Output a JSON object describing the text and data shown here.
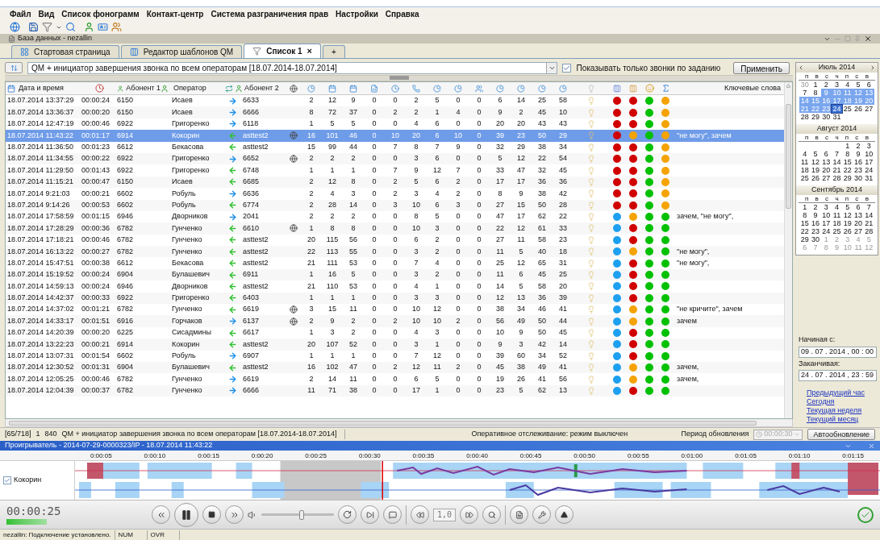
{
  "menu": [
    "Файл",
    "Вид",
    "Список фонограмм",
    "Контакт-центр",
    "Система разграничения прав",
    "Настройки",
    "Справка"
  ],
  "panel_title": "База данных - nezallin",
  "tabs": [
    {
      "label": "Стартовая страница",
      "selected": false,
      "kind": "page"
    },
    {
      "label": "Редактор шаблонов QM",
      "selected": false,
      "kind": "editor"
    },
    {
      "label": "Список 1",
      "selected": true,
      "kind": "list",
      "close": "×"
    },
    {
      "label": "+",
      "selected": false,
      "kind": "add"
    }
  ],
  "filter": {
    "value": "QM + инициатор завершения звонка по всем операторам [18.07.2014-18.07.2014]",
    "only_task_checkbox": {
      "label": "Показывать только звонки по заданию",
      "checked": true
    },
    "apply_button": "Применить"
  },
  "table": {
    "header": {
      "date": "Дата и время",
      "subscriber_1": "Абонент 1",
      "operator": "Оператор",
      "subscriber_2": "Абонент 2",
      "keywords": "Ключевые слова"
    },
    "rows": [
      {
        "cells": [
          "18.07.2014 13:37:29",
          "00:00:24",
          "6150",
          "Исаев",
          "6633"
        ],
        "kind": "outgoing",
        "marked": false,
        "nums": [
          "2",
          "12",
          "9",
          "0",
          "0",
          "2",
          "5",
          "0",
          "0",
          "6",
          "14",
          "25",
          "58"
        ],
        "dots": [
          {
            "color": "#d00000"
          },
          {
            "color": "#d00000"
          },
          {
            "color": "#00c000"
          },
          {
            "color": "#f5a300"
          }
        ],
        "selected": false
      },
      {
        "cells": [
          "18.07.2014 13:36:37",
          "00:00:20",
          "6150",
          "Исаев",
          "6666"
        ],
        "kind": "outgoing",
        "marked": false,
        "nums": [
          "8",
          "72",
          "37",
          "0",
          "2",
          "2",
          "1",
          "4",
          "0",
          "9",
          "2",
          "45",
          "10"
        ],
        "dots": [
          {
            "color": "#d00000"
          },
          {
            "color": "#d00000"
          },
          {
            "color": "#00c000"
          },
          {
            "color": "#f5a300"
          }
        ],
        "selected": false
      },
      {
        "cells": [
          "18.07.2014 12:47:19",
          "00:00:46",
          "6922",
          "Григоренко",
          "6118"
        ],
        "kind": "outgoing",
        "marked": false,
        "nums": [
          "1",
          "5",
          "5",
          "0",
          "0",
          "4",
          "6",
          "0",
          "0",
          "20",
          "20",
          "43",
          "43"
        ],
        "dots": [
          {
            "color": "#d00000"
          },
          {
            "color": "#d00000"
          },
          {
            "color": "#00c000"
          },
          {
            "color": "#f5a300"
          }
        ],
        "selected": false
      },
      {
        "cells": [
          "18.07.2014 11:43:22",
          "00:01:17",
          "6914",
          "Кокорин",
          "asttest2"
        ],
        "kind": "incoming",
        "marked": true,
        "nums": [
          "16",
          "101",
          "46",
          "0",
          "10",
          "20",
          "6",
          "10",
          "0",
          "39",
          "23",
          "50",
          "29"
        ],
        "dots": [
          {
            "color": "#d00000"
          },
          {
            "color": "#f5a300"
          },
          {
            "color": "#00c000"
          },
          {
            "color": "#f5a300"
          }
        ],
        "keywords": "\"не могу\", зачем",
        "selected": true
      },
      {
        "cells": [
          "18.07.2014 11:36:50",
          "00:01:23",
          "6612",
          "Бекасова",
          "asttest2"
        ],
        "kind": "incoming",
        "marked": false,
        "nums": [
          "15",
          "99",
          "44",
          "0",
          "7",
          "8",
          "7",
          "9",
          "0",
          "32",
          "29",
          "38",
          "34"
        ],
        "dots": [
          {
            "color": "#d00000"
          },
          {
            "color": "#d00000"
          },
          {
            "color": "#00c000"
          },
          {
            "color": "#f5a300"
          }
        ],
        "selected": false
      },
      {
        "cells": [
          "18.07.2014 11:34:55",
          "00:00:22",
          "6922",
          "Григоренко",
          "6652"
        ],
        "kind": "outgoing",
        "marked": true,
        "nums": [
          "2",
          "2",
          "2",
          "0",
          "0",
          "3",
          "6",
          "0",
          "0",
          "5",
          "12",
          "22",
          "54"
        ],
        "dots": [
          {
            "color": "#d00000"
          },
          {
            "color": "#d00000"
          },
          {
            "color": "#00c000"
          },
          {
            "color": "#f5a300"
          }
        ],
        "selected": false
      },
      {
        "cells": [
          "18.07.2014 11:29:50",
          "00:01:43",
          "6922",
          "Григоренко",
          "6748"
        ],
        "kind": "incoming",
        "marked": false,
        "nums": [
          "1",
          "1",
          "1",
          "0",
          "7",
          "9",
          "12",
          "7",
          "0",
          "33",
          "47",
          "32",
          "45"
        ],
        "dots": [
          {
            "color": "#d00000"
          },
          {
            "color": "#d00000"
          },
          {
            "color": "#00c000"
          },
          {
            "color": "#f5a300"
          }
        ],
        "selected": false
      },
      {
        "cells": [
          "18.07.2014 11:15:21",
          "00:00:47",
          "6150",
          "Исаев",
          "6685"
        ],
        "kind": "incoming",
        "marked": false,
        "nums": [
          "2",
          "12",
          "8",
          "0",
          "2",
          "5",
          "6",
          "2",
          "0",
          "17",
          "17",
          "36",
          "36"
        ],
        "dots": [
          {
            "color": "#d00000"
          },
          {
            "color": "#d00000"
          },
          {
            "color": "#00c000"
          },
          {
            "color": "#f5a300"
          }
        ],
        "selected": false
      },
      {
        "cells": [
          "18.07.2014 9:21:03",
          "00:00:21",
          "6602",
          "Робуль",
          "6636"
        ],
        "kind": "outgoing",
        "marked": false,
        "nums": [
          "2",
          "4",
          "3",
          "0",
          "2",
          "3",
          "4",
          "2",
          "0",
          "8",
          "9",
          "38",
          "42"
        ],
        "dots": [
          {
            "color": "#d00000"
          },
          {
            "color": "#d00000"
          },
          {
            "color": "#00c000"
          },
          {
            "color": "#f5a300"
          }
        ],
        "selected": false
      },
      {
        "cells": [
          "18.07.2014 9:14:26",
          "00:00:53",
          "6602",
          "Робуль",
          "6774"
        ],
        "kind": "incoming",
        "marked": false,
        "nums": [
          "2",
          "28",
          "14",
          "0",
          "3",
          "10",
          "6",
          "3",
          "0",
          "27",
          "15",
          "50",
          "28"
        ],
        "dots": [
          {
            "color": "#d00000"
          },
          {
            "color": "#d00000"
          },
          {
            "color": "#00c000"
          },
          {
            "color": "#f5a300"
          }
        ],
        "selected": false
      },
      {
        "cells": [
          "18.07.2014 17:58:59",
          "00:01:15",
          "6946",
          "Дворников",
          "2041"
        ],
        "kind": "outgoing",
        "marked": false,
        "nums": [
          "2",
          "2",
          "2",
          "0",
          "0",
          "8",
          "5",
          "0",
          "0",
          "47",
          "17",
          "62",
          "22"
        ],
        "dots": [
          {
            "color": "#1ea0f0"
          },
          {
            "color": "#f5a300"
          },
          {
            "color": "#00c000"
          },
          {
            "color": "#00c000"
          }
        ],
        "keywords": "зачем, \"не могу\",",
        "selected": false
      },
      {
        "cells": [
          "18.07.2014 17:28:29",
          "00:00:36",
          "6782",
          "Гунченко",
          "6610"
        ],
        "kind": "incoming",
        "marked": true,
        "nums": [
          "1",
          "8",
          "8",
          "0",
          "0",
          "10",
          "3",
          "0",
          "0",
          "22",
          "12",
          "61",
          "33"
        ],
        "dots": [
          {
            "color": "#1ea0f0"
          },
          {
            "color": "#d00000"
          },
          {
            "color": "#00c000"
          },
          {
            "color": "#00c000"
          }
        ],
        "selected": false
      },
      {
        "cells": [
          "18.07.2014 17:18:21",
          "00:00:46",
          "6782",
          "Гунченко",
          "asttest2"
        ],
        "kind": "incoming",
        "marked": false,
        "nums": [
          "20",
          "115",
          "56",
          "0",
          "0",
          "6",
          "2",
          "0",
          "0",
          "27",
          "11",
          "58",
          "23"
        ],
        "dots": [
          {
            "color": "#1ea0f0"
          },
          {
            "color": "#d00000"
          },
          {
            "color": "#00c000"
          },
          {
            "color": "#00c000"
          }
        ],
        "selected": false
      },
      {
        "cells": [
          "18.07.2014 16:13:22",
          "00:00:27",
          "6782",
          "Гунченко",
          "asttest2"
        ],
        "kind": "incoming",
        "marked": false,
        "nums": [
          "22",
          "113",
          "55",
          "0",
          "0",
          "3",
          "2",
          "0",
          "0",
          "11",
          "5",
          "40",
          "18"
        ],
        "dots": [
          {
            "color": "#1ea0f0"
          },
          {
            "color": "#f5a300"
          },
          {
            "color": "#00c000"
          },
          {
            "color": "#00c000"
          }
        ],
        "keywords": "\"не могу\",",
        "selected": false
      },
      {
        "cells": [
          "18.07.2014 15:47:51",
          "00:00:38",
          "6612",
          "Бекасова",
          "asttest2"
        ],
        "kind": "incoming",
        "marked": false,
        "nums": [
          "21",
          "111",
          "53",
          "0",
          "0",
          "7",
          "4",
          "0",
          "0",
          "25",
          "12",
          "65",
          "31"
        ],
        "dots": [
          {
            "color": "#1ea0f0"
          },
          {
            "color": "#d00000"
          },
          {
            "color": "#00c000"
          },
          {
            "color": "#00c000"
          }
        ],
        "keywords": "\"не могу\",",
        "selected": false
      },
      {
        "cells": [
          "18.07.2014 15:19:52",
          "00:00:24",
          "6904",
          "Булашевич",
          "6911"
        ],
        "kind": "incoming",
        "marked": false,
        "nums": [
          "1",
          "16",
          "5",
          "0",
          "0",
          "3",
          "2",
          "0",
          "0",
          "11",
          "6",
          "45",
          "25"
        ],
        "dots": [
          {
            "color": "#1ea0f0"
          },
          {
            "color": "#d00000"
          },
          {
            "color": "#00c000"
          },
          {
            "color": "#00c000"
          }
        ],
        "selected": false
      },
      {
        "cells": [
          "18.07.2014 14:59:13",
          "00:00:24",
          "6946",
          "Дворников",
          "asttest2"
        ],
        "kind": "incoming",
        "marked": false,
        "nums": [
          "21",
          "110",
          "53",
          "0",
          "0",
          "4",
          "1",
          "0",
          "0",
          "14",
          "5",
          "58",
          "20"
        ],
        "dots": [
          {
            "color": "#1ea0f0"
          },
          {
            "color": "#d00000"
          },
          {
            "color": "#00c000"
          },
          {
            "color": "#00c000"
          }
        ],
        "selected": false
      },
      {
        "cells": [
          "18.07.2014 14:42:37",
          "00:00:33",
          "6922",
          "Григоренко",
          "6403"
        ],
        "kind": "incoming",
        "marked": false,
        "nums": [
          "1",
          "1",
          "1",
          "0",
          "0",
          "3",
          "3",
          "0",
          "0",
          "12",
          "13",
          "36",
          "39"
        ],
        "dots": [
          {
            "color": "#1ea0f0"
          },
          {
            "color": "#d00000"
          },
          {
            "color": "#00c000"
          },
          {
            "color": "#00c000"
          }
        ],
        "selected": false
      },
      {
        "cells": [
          "18.07.2014 14:37:02",
          "00:01:21",
          "6782",
          "Гунченко",
          "6619"
        ],
        "kind": "incoming",
        "marked": true,
        "nums": [
          "3",
          "15",
          "11",
          "0",
          "0",
          "10",
          "12",
          "0",
          "0",
          "38",
          "34",
          "46",
          "41"
        ],
        "dots": [
          {
            "color": "#1ea0f0"
          },
          {
            "color": "#f5a300"
          },
          {
            "color": "#00c000"
          },
          {
            "color": "#00c000"
          }
        ],
        "keywords": "\"не кричите\", зачем",
        "selected": false
      },
      {
        "cells": [
          "18.07.2014 14:33:17",
          "00:01:51",
          "6916",
          "Горчаков",
          "6137"
        ],
        "kind": "outgoing",
        "marked": true,
        "nums": [
          "2",
          "9",
          "2",
          "0",
          "2",
          "10",
          "10",
          "2",
          "0",
          "56",
          "49",
          "50",
          "44"
        ],
        "dots": [
          {
            "color": "#1ea0f0"
          },
          {
            "color": "#f5a300"
          },
          {
            "color": "#00c000"
          },
          {
            "color": "#00c000"
          }
        ],
        "keywords": "зачем",
        "selected": false
      },
      {
        "cells": [
          "18.07.2014 14:20:39",
          "00:00:20",
          "6225",
          "Сисадмины",
          "6617"
        ],
        "kind": "incoming",
        "marked": false,
        "nums": [
          "1",
          "3",
          "2",
          "0",
          "0",
          "4",
          "3",
          "0",
          "0",
          "10",
          "9",
          "50",
          "45"
        ],
        "dots": [
          {
            "color": "#1ea0f0"
          },
          {
            "color": "#d00000"
          },
          {
            "color": "#00c000"
          },
          {
            "color": "#00c000"
          }
        ],
        "selected": false
      },
      {
        "cells": [
          "18.07.2014 13:22:23",
          "00:00:21",
          "6914",
          "Кокорин",
          "asttest2"
        ],
        "kind": "incoming",
        "marked": false,
        "nums": [
          "20",
          "107",
          "52",
          "0",
          "0",
          "3",
          "1",
          "0",
          "0",
          "9",
          "3",
          "42",
          "14"
        ],
        "dots": [
          {
            "color": "#1ea0f0"
          },
          {
            "color": "#d00000"
          },
          {
            "color": "#00c000"
          },
          {
            "color": "#00c000"
          }
        ],
        "selected": false
      },
      {
        "cells": [
          "18.07.2014 13:07:31",
          "00:01:54",
          "6602",
          "Робуль",
          "6907"
        ],
        "kind": "outgoing",
        "marked": false,
        "nums": [
          "1",
          "1",
          "1",
          "0",
          "0",
          "7",
          "12",
          "0",
          "0",
          "39",
          "60",
          "34",
          "52"
        ],
        "dots": [
          {
            "color": "#1ea0f0"
          },
          {
            "color": "#d00000"
          },
          {
            "color": "#00c000"
          },
          {
            "color": "#00c000"
          }
        ],
        "selected": false
      },
      {
        "cells": [
          "18.07.2014 12:30:52",
          "00:01:31",
          "6904",
          "Булашевич",
          "asttest2"
        ],
        "kind": "incoming",
        "marked": false,
        "nums": [
          "16",
          "102",
          "47",
          "0",
          "2",
          "12",
          "11",
          "2",
          "0",
          "45",
          "38",
          "49",
          "41"
        ],
        "dots": [
          {
            "color": "#1ea0f0"
          },
          {
            "color": "#f5a300"
          },
          {
            "color": "#00c000"
          },
          {
            "color": "#00c000"
          }
        ],
        "keywords": "зачем,",
        "selected": false
      },
      {
        "cells": [
          "18.07.2014 12:05:25",
          "00:00:46",
          "6782",
          "Гунченко",
          "6619"
        ],
        "kind": "outgoing",
        "marked": false,
        "nums": [
          "2",
          "14",
          "11",
          "0",
          "0",
          "6",
          "5",
          "0",
          "0",
          "19",
          "26",
          "41",
          "56"
        ],
        "dots": [
          {
            "color": "#1ea0f0"
          },
          {
            "color": "#f5a300"
          },
          {
            "color": "#00c000"
          },
          {
            "color": "#00c000"
          }
        ],
        "keywords": "зачем,",
        "selected": false
      },
      {
        "cells": [
          "18.07.2014 12:04:39",
          "00:00:37",
          "6782",
          "Гунченко",
          "6666"
        ],
        "kind": "outgoing",
        "marked": false,
        "nums": [
          "11",
          "71",
          "38",
          "0",
          "0",
          "17",
          "1",
          "0",
          "0",
          "23",
          "5",
          "62",
          "13"
        ],
        "dots": [
          {
            "color": "#1ea0f0"
          },
          {
            "color": "#d00000"
          },
          {
            "color": "#00c000"
          },
          {
            "color": "#00c000"
          }
        ],
        "selected": false
      }
    ]
  },
  "calendar": {
    "months": [
      {
        "title": "Июль 2014",
        "weekdays": [
          "п",
          "в",
          "с",
          "ч",
          "п",
          "с",
          "в"
        ],
        "weeks": [
          [
            {
              "d": "30",
              "muted": true,
              "selected": false,
              "current": false
            },
            {
              "d": "1",
              "muted": false,
              "selected": false,
              "current": false
            },
            {
              "d": "2",
              "muted": false,
              "selected": false,
              "current": false
            },
            {
              "d": "3",
              "muted": false,
              "selected": false,
              "current": false
            },
            {
              "d": "4",
              "muted": false,
              "selected": false,
              "current": false
            },
            {
              "d": "5",
              "muted": false,
              "selected": false,
              "current": false
            },
            {
              "d": "6",
              "muted": false,
              "selected": false,
              "current": false
            }
          ],
          [
            {
              "d": "7",
              "muted": false,
              "selected": false,
              "current": false
            },
            {
              "d": "8",
              "muted": false,
              "selected": false,
              "current": false
            },
            {
              "d": "9",
              "muted": false,
              "selected": true,
              "current": false
            },
            {
              "d": "10",
              "muted": false,
              "selected": true,
              "current": false
            },
            {
              "d": "11",
              "muted": false,
              "selected": true,
              "current": false
            },
            {
              "d": "12",
              "muted": false,
              "selected": true,
              "current": false
            },
            {
              "d": "13",
              "muted": false,
              "selected": true,
              "current": false
            }
          ],
          [
            {
              "d": "14",
              "muted": false,
              "selected": true,
              "current": false
            },
            {
              "d": "15",
              "muted": false,
              "selected": true,
              "current": false
            },
            {
              "d": "16",
              "muted": false,
              "selected": true,
              "current": false
            },
            {
              "d": "17",
              "muted": false,
              "selected": true,
              "current": false
            },
            {
              "d": "18",
              "muted": false,
              "selected": true,
              "current": false
            },
            {
              "d": "19",
              "muted": false,
              "selected": true,
              "current": false
            },
            {
              "d": "20",
              "muted": false,
              "selected": true,
              "current": false
            }
          ],
          [
            {
              "d": "21",
              "muted": false,
              "selected": true,
              "current": false
            },
            {
              "d": "22",
              "muted": false,
              "selected": true,
              "current": false
            },
            {
              "d": "23",
              "muted": false,
              "selected": true,
              "current": false
            },
            {
              "d": "24",
              "muted": false,
              "selected": true,
              "current": true
            },
            {
              "d": "25",
              "muted": false,
              "selected": false,
              "current": false
            },
            {
              "d": "26",
              "muted": false,
              "selected": false,
              "current": false
            },
            {
              "d": "27",
              "muted": false,
              "selected": false,
              "current": false
            }
          ],
          [
            {
              "d": "28",
              "muted": false,
              "selected": false,
              "current": false
            },
            {
              "d": "29",
              "muted": false,
              "selected": false,
              "current": false
            },
            {
              "d": "30",
              "muted": false,
              "selected": false,
              "current": false
            },
            {
              "d": "31",
              "muted": false,
              "selected": false,
              "current": false
            }
          ]
        ]
      },
      {
        "title": "Август 2014",
        "weekdays": [
          "п",
          "в",
          "с",
          "ч",
          "п",
          "с",
          "в"
        ],
        "weeks": [
          [
            {
              "d": "1",
              "muted": false,
              "selected": false,
              "current": false
            },
            {
              "d": "2",
              "muted": false,
              "selected": false,
              "current": false
            },
            {
              "d": "3",
              "muted": false,
              "selected": false,
              "current": false
            }
          ],
          [
            {
              "d": "4",
              "muted": false,
              "selected": false,
              "current": false
            },
            {
              "d": "5",
              "muted": false,
              "selected": false,
              "current": false
            },
            {
              "d": "6",
              "muted": false,
              "selected": false,
              "current": false
            },
            {
              "d": "7",
              "muted": false,
              "selected": false,
              "current": false
            },
            {
              "d": "8",
              "muted": false,
              "selected": false,
              "current": false
            },
            {
              "d": "9",
              "muted": false,
              "selected": false,
              "current": false
            },
            {
              "d": "10",
              "muted": false,
              "selected": false,
              "current": false
            }
          ],
          [
            {
              "d": "11",
              "muted": false,
              "selected": false,
              "current": false
            },
            {
              "d": "12",
              "muted": false,
              "selected": false,
              "current": false
            },
            {
              "d": "13",
              "muted": false,
              "selected": false,
              "current": false
            },
            {
              "d": "14",
              "muted": false,
              "selected": false,
              "current": false
            },
            {
              "d": "15",
              "muted": false,
              "selected": false,
              "current": false
            },
            {
              "d": "16",
              "muted": false,
              "selected": false,
              "current": false
            },
            {
              "d": "17",
              "muted": false,
              "selected": false,
              "current": false
            }
          ],
          [
            {
              "d": "18",
              "muted": false,
              "selected": false,
              "current": false
            },
            {
              "d": "19",
              "muted": false,
              "selected": false,
              "current": false
            },
            {
              "d": "20",
              "muted": false,
              "selected": false,
              "current": false
            },
            {
              "d": "21",
              "muted": false,
              "selected": false,
              "current": false
            },
            {
              "d": "22",
              "muted": false,
              "selected": false,
              "current": false
            },
            {
              "d": "23",
              "muted": false,
              "selected": false,
              "current": false
            },
            {
              "d": "24",
              "muted": false,
              "selected": false,
              "current": false
            }
          ],
          [
            {
              "d": "25",
              "muted": false,
              "selected": false,
              "current": false
            },
            {
              "d": "26",
              "muted": false,
              "selected": false,
              "current": false
            },
            {
              "d": "27",
              "muted": false,
              "selected": false,
              "current": false
            },
            {
              "d": "28",
              "muted": false,
              "selected": false,
              "current": false
            },
            {
              "d": "29",
              "muted": false,
              "selected": false,
              "current": false
            },
            {
              "d": "30",
              "muted": false,
              "selected": false,
              "current": false
            },
            {
              "d": "31",
              "muted": false,
              "selected": false,
              "current": false
            }
          ]
        ]
      },
      {
        "title": "Сентябрь 2014",
        "weekdays": [
          "п",
          "в",
          "с",
          "ч",
          "п",
          "с",
          "в"
        ],
        "weeks": [
          [
            {
              "d": "1",
              "muted": false,
              "selected": false,
              "current": false
            },
            {
              "d": "2",
              "muted": false,
              "selected": false,
              "current": false
            },
            {
              "d": "3",
              "muted": false,
              "selected": false,
              "current": false
            },
            {
              "d": "4",
              "muted": false,
              "selected": false,
              "current": false
            },
            {
              "d": "5",
              "muted": false,
              "selected": false,
              "current": false
            },
            {
              "d": "6",
              "muted": false,
              "selected": false,
              "current": false
            },
            {
              "d": "7",
              "muted": false,
              "selected": false,
              "current": false
            }
          ],
          [
            {
              "d": "8",
              "muted": false,
              "selected": false,
              "current": false
            },
            {
              "d": "9",
              "muted": false,
              "selected": false,
              "current": false
            },
            {
              "d": "10",
              "muted": false,
              "selected": false,
              "current": false
            },
            {
              "d": "11",
              "muted": false,
              "selected": false,
              "current": false
            },
            {
              "d": "12",
              "muted": false,
              "selected": false,
              "current": false
            },
            {
              "d": "13",
              "muted": false,
              "selected": false,
              "current": false
            },
            {
              "d": "14",
              "muted": false,
              "selected": false,
              "current": false
            }
          ],
          [
            {
              "d": "15",
              "muted": false,
              "selected": false,
              "current": false
            },
            {
              "d": "16",
              "muted": false,
              "selected": false,
              "current": false
            },
            {
              "d": "17",
              "muted": false,
              "selected": false,
              "current": false
            },
            {
              "d": "18",
              "muted": false,
              "selected": false,
              "current": false
            },
            {
              "d": "19",
              "muted": false,
              "selected": false,
              "current": false
            },
            {
              "d": "20",
              "muted": false,
              "selected": false,
              "current": false
            },
            {
              "d": "21",
              "muted": false,
              "selected": false,
              "current": false
            }
          ],
          [
            {
              "d": "22",
              "muted": false,
              "selected": false,
              "current": false
            },
            {
              "d": "23",
              "muted": false,
              "selected": false,
              "current": false
            },
            {
              "d": "24",
              "muted": false,
              "selected": false,
              "current": false
            },
            {
              "d": "25",
              "muted": false,
              "selected": false,
              "current": false
            },
            {
              "d": "26",
              "muted": false,
              "selected": false,
              "current": false
            },
            {
              "d": "27",
              "muted": false,
              "selected": false,
              "current": false
            },
            {
              "d": "28",
              "muted": false,
              "selected": false,
              "current": false
            }
          ],
          [
            {
              "d": "29",
              "muted": false,
              "selected": false,
              "current": false
            },
            {
              "d": "30",
              "muted": false,
              "selected": false,
              "current": false
            },
            {
              "d": "1",
              "muted": true,
              "selected": false,
              "current": false
            },
            {
              "d": "2",
              "muted": true,
              "selected": false,
              "current": false
            },
            {
              "d": "3",
              "muted": true,
              "selected": false,
              "current": false
            },
            {
              "d": "4",
              "muted": true,
              "selected": false,
              "current": false
            },
            {
              "d": "5",
              "muted": true,
              "selected": false,
              "current": false
            }
          ],
          [
            {
              "d": "6",
              "muted": true,
              "selected": false,
              "current": false
            },
            {
              "d": "7",
              "muted": true,
              "selected": false,
              "current": false
            },
            {
              "d": "8",
              "muted": true,
              "selected": false,
              "current": false
            },
            {
              "d": "9",
              "muted": true,
              "selected": false,
              "current": false
            },
            {
              "d": "10",
              "muted": true,
              "selected": false,
              "current": false
            },
            {
              "d": "11",
              "muted": true,
              "selected": false,
              "current": false
            },
            {
              "d": "12",
              "muted": true,
              "selected": false,
              "current": false
            }
          ]
        ]
      }
    ]
  },
  "range": {
    "from_label": "Начиная с:",
    "from": "09 . 07 . 2014 , 00 : 00",
    "to_label": "Заканчивая:",
    "to": "24 . 07 . 2014 , 23 : 59",
    "links": [
      "Предыдущий час",
      "Сегодня",
      "Текущая неделя",
      "Текущий месяц"
    ]
  },
  "status": {
    "count": "[65/718]",
    "column_2": "1",
    "column_3": "840",
    "query": "QM + инициатор завершения звонка по всем операторам [18.07.2014-18.07.2014]",
    "tracking": "Оперативное отслеживание: режим выключен",
    "period_label": "Период обновления",
    "period": "00:00:30",
    "period_disabled": true,
    "auto_button": "Автообновление"
  },
  "player": {
    "title": "Проигрыватель - 2014-07-29-0000323/IP - 18.07.2014 11:43:22",
    "ticks": [
      "0:00:05",
      "0:00:10",
      "0:00:15",
      "0:00:20",
      "0:00:25",
      "0:00:30",
      "0:00:35",
      "0:00:40",
      "0:00:45",
      "0:00:50",
      "0:00:55",
      "0:01:00",
      "0:01:05",
      "0:01:10",
      "0:01:15"
    ],
    "track": {
      "label": "Кокорин",
      "checked": true
    },
    "time": "00:00:25",
    "volume": {
      "level": 0.55
    },
    "speed": "1,0"
  },
  "status_bar": [
    "nezallin: Подключение установлено.",
    "NUM",
    "OVR"
  ]
}
